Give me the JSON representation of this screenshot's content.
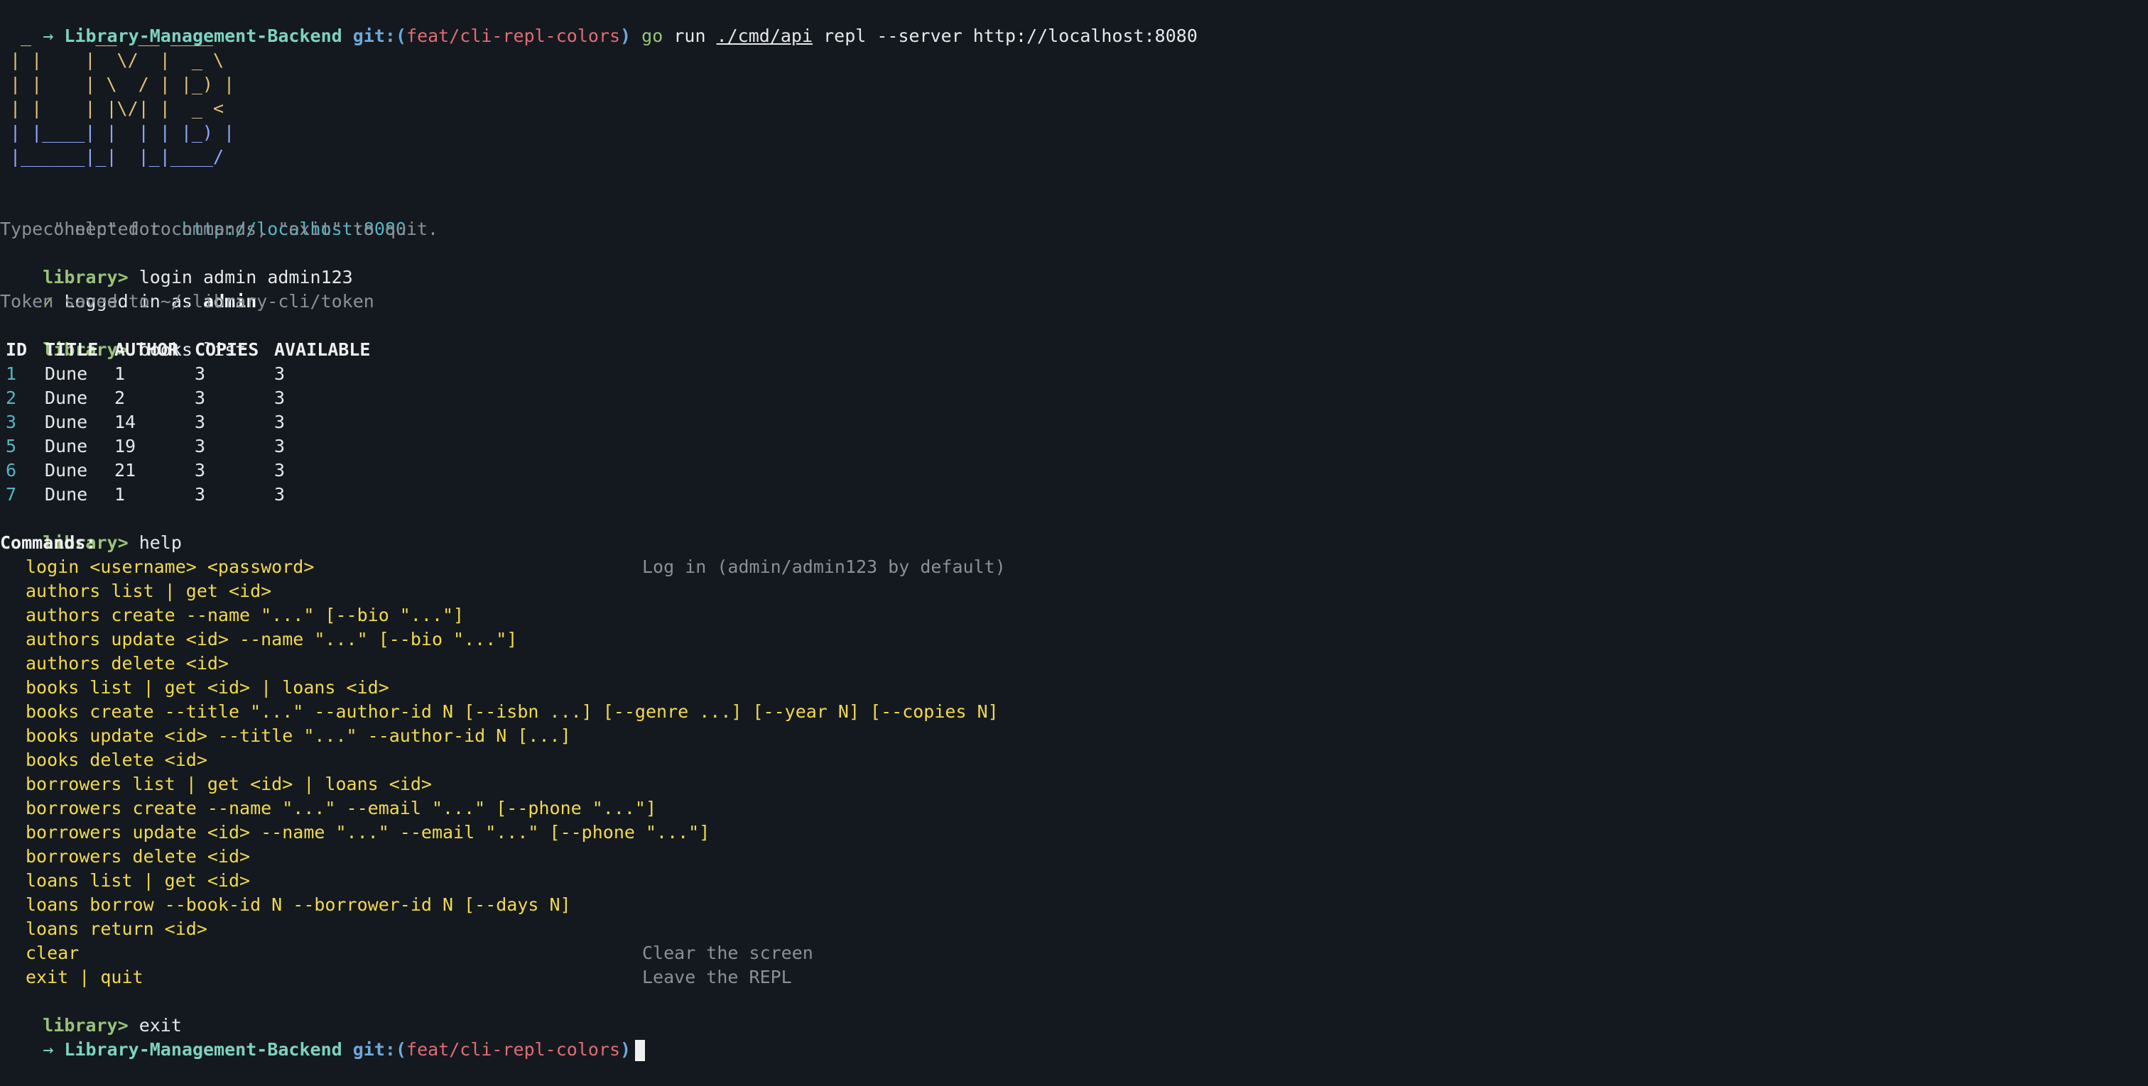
{
  "prompt": {
    "arrow": "→",
    "dir": "Library-Management-Backend",
    "git_prefix": "git:(",
    "branch": "feat/cli-repl-colors",
    "git_suffix": ")"
  },
  "initial_command": {
    "cmd": "go",
    "arg1": "run",
    "path": "./cmd/api",
    "rest": "repl --server http://localhost:8080"
  },
  "ascii_art": [
    " _      __  __ ____  ",
    "| |    |  \\/  |  _ \\ ",
    "| |    | \\  / | |_) |",
    "| |    | |\\/| |  _ < ",
    "| |____| |  | | |_) |",
    "|______|_|  |_|____/ "
  ],
  "banner": {
    "connected_prefix": "connected to ",
    "connected_url": "http://localhost:8080",
    "hint": "Type \"help\" for commands, \"exit\" to quit."
  },
  "repl_prompt": "library>",
  "session": {
    "login_cmd": "login admin admin123",
    "login_check": "✓",
    "login_msg_prefix": "Logged in as ",
    "login_user": "admin",
    "token_msg": "Token saved to ~/.library-cli/token",
    "books_cmd": "books list",
    "help_cmd": "help",
    "exit_cmd": "exit"
  },
  "books_table": {
    "headers": [
      "ID",
      "TITLE",
      "AUTHOR",
      "COPIES",
      "AVAILABLE"
    ],
    "rows": [
      [
        "1",
        "Dune",
        "1",
        "3",
        "3"
      ],
      [
        "2",
        "Dune",
        "2",
        "3",
        "3"
      ],
      [
        "3",
        "Dune",
        "14",
        "3",
        "3"
      ],
      [
        "5",
        "Dune",
        "19",
        "3",
        "3"
      ],
      [
        "6",
        "Dune",
        "21",
        "3",
        "3"
      ],
      [
        "7",
        "Dune",
        "1",
        "3",
        "3"
      ]
    ]
  },
  "help": {
    "title": "Commands:",
    "commands": [
      {
        "cmd": "login <username> <password>",
        "desc": "Log in (admin/admin123 by default)"
      },
      {
        "cmd": "authors list | get <id>",
        "desc": ""
      },
      {
        "cmd": "authors create --name \"...\" [--bio \"...\"]",
        "desc": ""
      },
      {
        "cmd": "authors update <id> --name \"...\" [--bio \"...\"]",
        "desc": ""
      },
      {
        "cmd": "authors delete <id>",
        "desc": ""
      },
      {
        "cmd": "books list | get <id> | loans <id>",
        "desc": ""
      },
      {
        "cmd": "books create --title \"...\" --author-id N [--isbn ...] [--genre ...] [--year N] [--copies N]",
        "desc": ""
      },
      {
        "cmd": "books update <id> --title \"...\" --author-id N [...]",
        "desc": ""
      },
      {
        "cmd": "books delete <id>",
        "desc": ""
      },
      {
        "cmd": "borrowers list | get <id> | loans <id>",
        "desc": ""
      },
      {
        "cmd": "borrowers create --name \"...\" --email \"...\" [--phone \"...\"]",
        "desc": ""
      },
      {
        "cmd": "borrowers update <id> --name \"...\" --email \"...\" [--phone \"...\"]",
        "desc": ""
      },
      {
        "cmd": "borrowers delete <id>",
        "desc": ""
      },
      {
        "cmd": "loans list | get <id>",
        "desc": ""
      },
      {
        "cmd": "loans borrow --book-id N --borrower-id N [--days N]",
        "desc": ""
      },
      {
        "cmd": "loans return <id>",
        "desc": ""
      },
      {
        "cmd": "clear",
        "desc": "Clear the screen"
      },
      {
        "cmd": "exit | quit",
        "desc": "Leave the REPL"
      }
    ]
  }
}
